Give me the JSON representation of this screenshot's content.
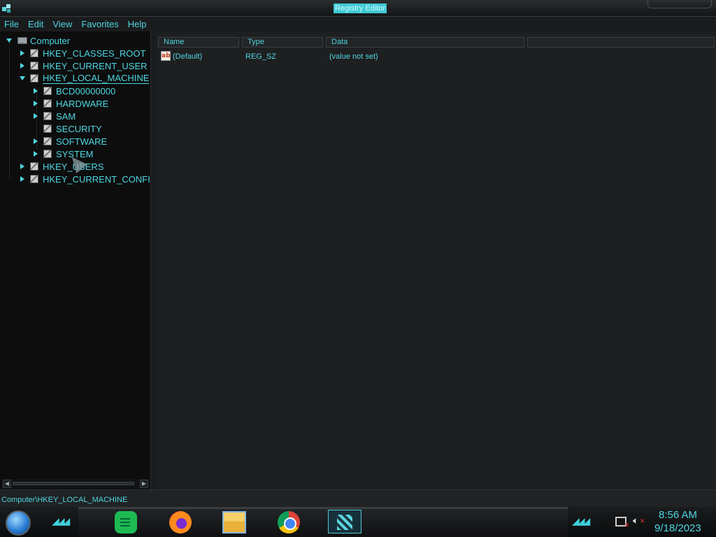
{
  "window": {
    "title": "Registry Editor"
  },
  "menu": [
    "File",
    "Edit",
    "View",
    "Favorites",
    "Help"
  ],
  "tree": {
    "root": "Computer",
    "hives": [
      {
        "label": "HKEY_CLASSES_ROOT",
        "state": "collapsed"
      },
      {
        "label": "HKEY_CURRENT_USER",
        "state": "collapsed"
      },
      {
        "label": "HKEY_LOCAL_MACHINE",
        "state": "expanded",
        "selected": true,
        "children": [
          {
            "label": "BCD00000000",
            "state": "collapsed"
          },
          {
            "label": "HARDWARE",
            "state": "collapsed"
          },
          {
            "label": "SAM",
            "state": "collapsed"
          },
          {
            "label": "SECURITY",
            "state": "none"
          },
          {
            "label": "SOFTWARE",
            "state": "collapsed"
          },
          {
            "label": "SYSTEM",
            "state": "collapsed"
          }
        ]
      },
      {
        "label": "HKEY_USERS",
        "state": "collapsed"
      },
      {
        "label": "HKEY_CURRENT_CONFI",
        "state": "collapsed"
      }
    ]
  },
  "list": {
    "columns": [
      "Name",
      "Type",
      "Data"
    ],
    "rows": [
      {
        "name": "(Default)",
        "type": "REG_SZ",
        "data": "(value not set)",
        "icon": "ab-string-icon"
      }
    ]
  },
  "status": {
    "path": "Computer\\HKEY_LOCAL_MACHINE"
  },
  "taskbar": {
    "apps": [
      "notes-app-icon",
      "firefox-icon",
      "file-explorer-icon",
      "chrome-icon",
      "regedit-icon"
    ],
    "clock": {
      "time": "8:56 AM",
      "date": "9/18/2023"
    }
  },
  "colors": {
    "accent": "#4fd6e0",
    "background": "#0d0d0e",
    "panel": "#1e1f21"
  }
}
